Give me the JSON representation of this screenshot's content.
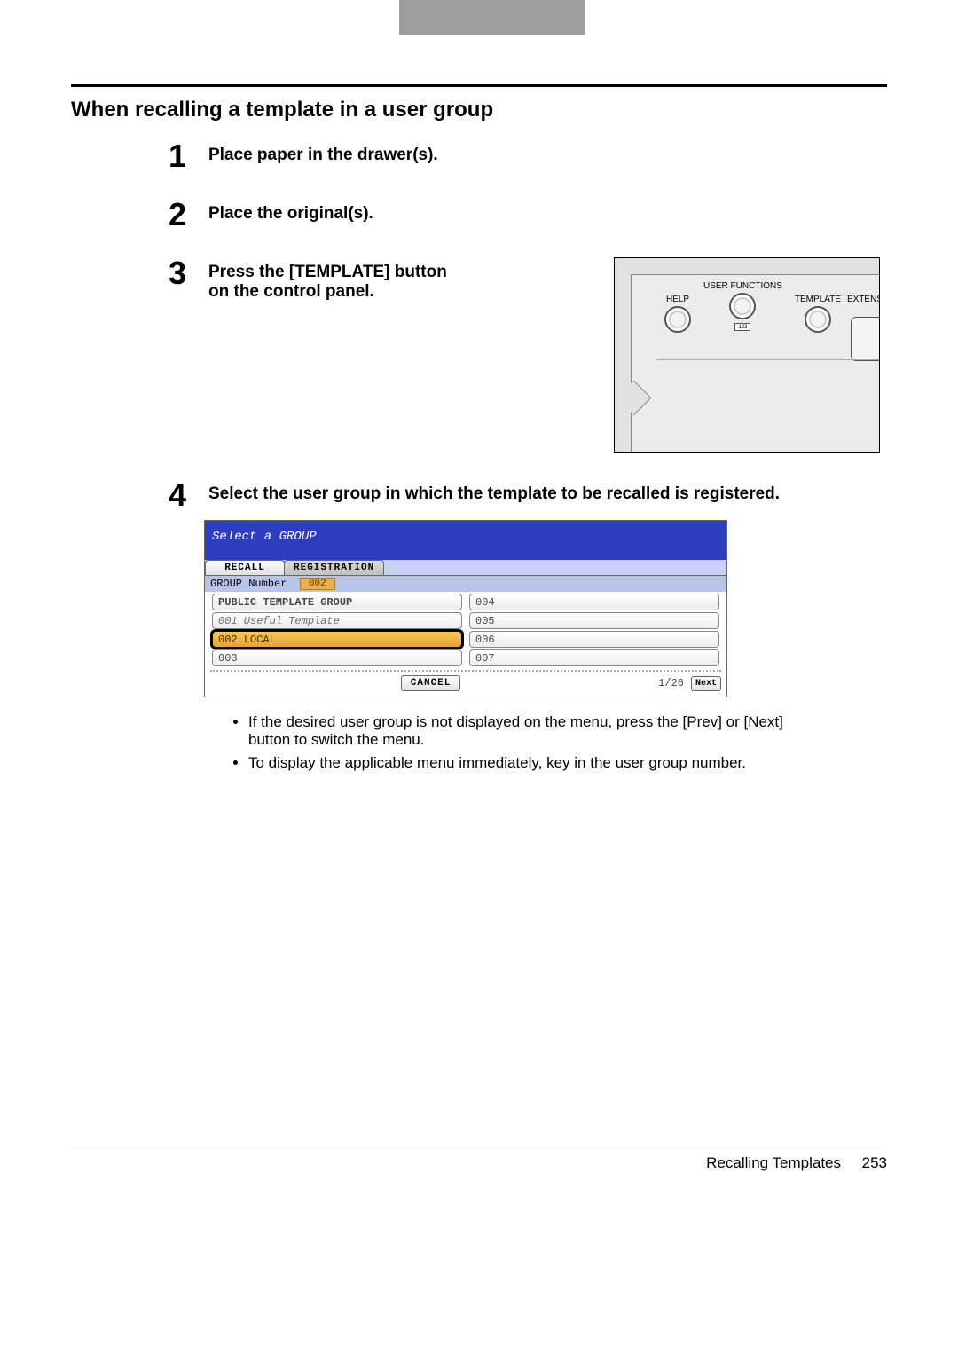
{
  "section_title": "When recalling a template in a user group",
  "steps": {
    "s1_num": "1",
    "s1_text": "Place paper in the drawer(s).",
    "s2_num": "2",
    "s2_text": "Place the original(s).",
    "s3_num": "3",
    "s3_text": "Press the [TEMPLATE] button on the control panel.",
    "s4_num": "4",
    "s4_text": "Select the user group in which the template to be recalled is registered."
  },
  "control_panel": {
    "help": "HELP",
    "user_functions": "USER FUNCTIONS",
    "template": "TEMPLATE",
    "extension": "EXTENSION",
    "counter": "123"
  },
  "screen": {
    "header": "Select a GROUP",
    "tab_recall": "RECALL",
    "tab_registration": "REGISTRATION",
    "group_number_label": "GROUP Number",
    "group_number_value": "002",
    "left_items": [
      {
        "text": "PUBLIC TEMPLATE GROUP",
        "classes": "bold"
      },
      {
        "text": "001 Useful Template",
        "classes": "italic"
      },
      {
        "text": "002 LOCAL",
        "classes": "selected"
      },
      {
        "text": "003",
        "classes": ""
      }
    ],
    "right_items": [
      {
        "text": "004",
        "classes": ""
      },
      {
        "text": "005",
        "classes": ""
      },
      {
        "text": "006",
        "classes": ""
      },
      {
        "text": "007",
        "classes": ""
      }
    ],
    "cancel": "CANCEL",
    "page_indicator": "1/26",
    "next": "Next"
  },
  "bullets": {
    "b1": "If the desired user group is not displayed on the menu, press the [Prev] or [Next] button to switch the menu.",
    "b2": "To display the applicable menu immediately, key in the user group number."
  },
  "footer": {
    "title": "Recalling Templates",
    "page": "253"
  }
}
